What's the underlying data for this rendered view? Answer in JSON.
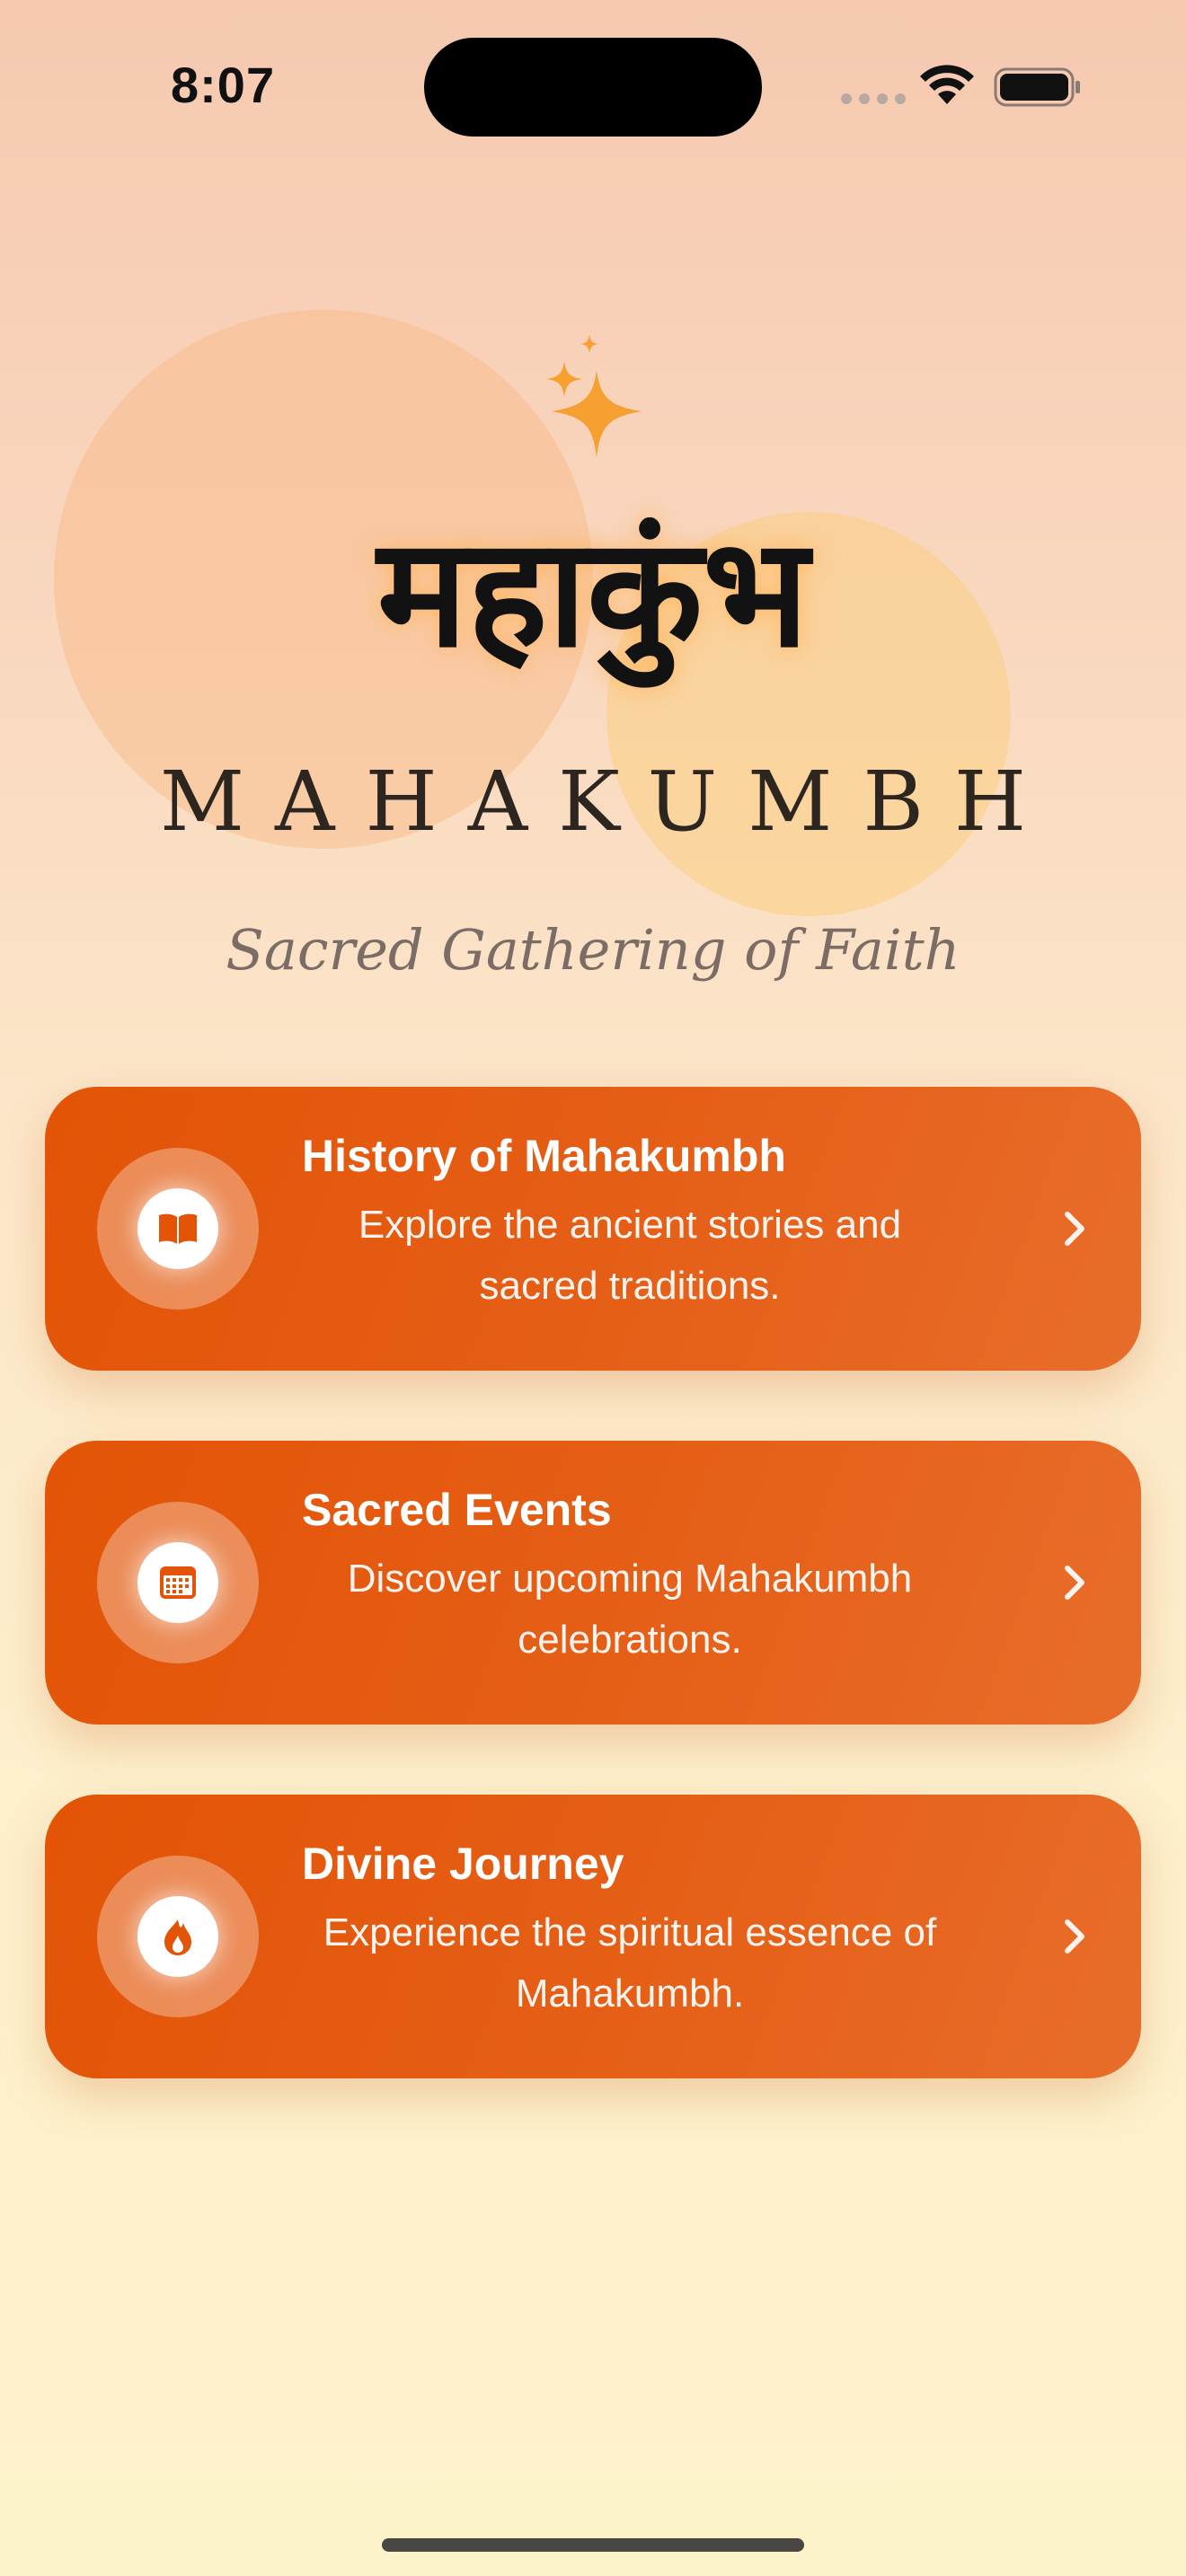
{
  "status_bar": {
    "time": "8:07"
  },
  "header": {
    "hindi_title": "महाकुंभ",
    "english_title": "MAHAKUMBH",
    "tagline": "Sacred Gathering of Faith",
    "sparkle_icon": "sparkles-icon",
    "sparkle_color": "#f5a030"
  },
  "cards": [
    {
      "title": "History of Mahakumbh",
      "description": "Explore the ancient stories and sacred traditions.",
      "icon": "book-icon"
    },
    {
      "title": "Sacred Events",
      "description": "Discover upcoming Mahakumbh celebrations.",
      "icon": "calendar-icon"
    },
    {
      "title": "Divine Journey",
      "description": "Experience the spiritual essence of Mahakumbh.",
      "icon": "flame-icon"
    }
  ],
  "colors": {
    "card_gradient_start": "#e35406",
    "card_gradient_end": "#e86d2a",
    "icon_accent": "#e35406"
  }
}
